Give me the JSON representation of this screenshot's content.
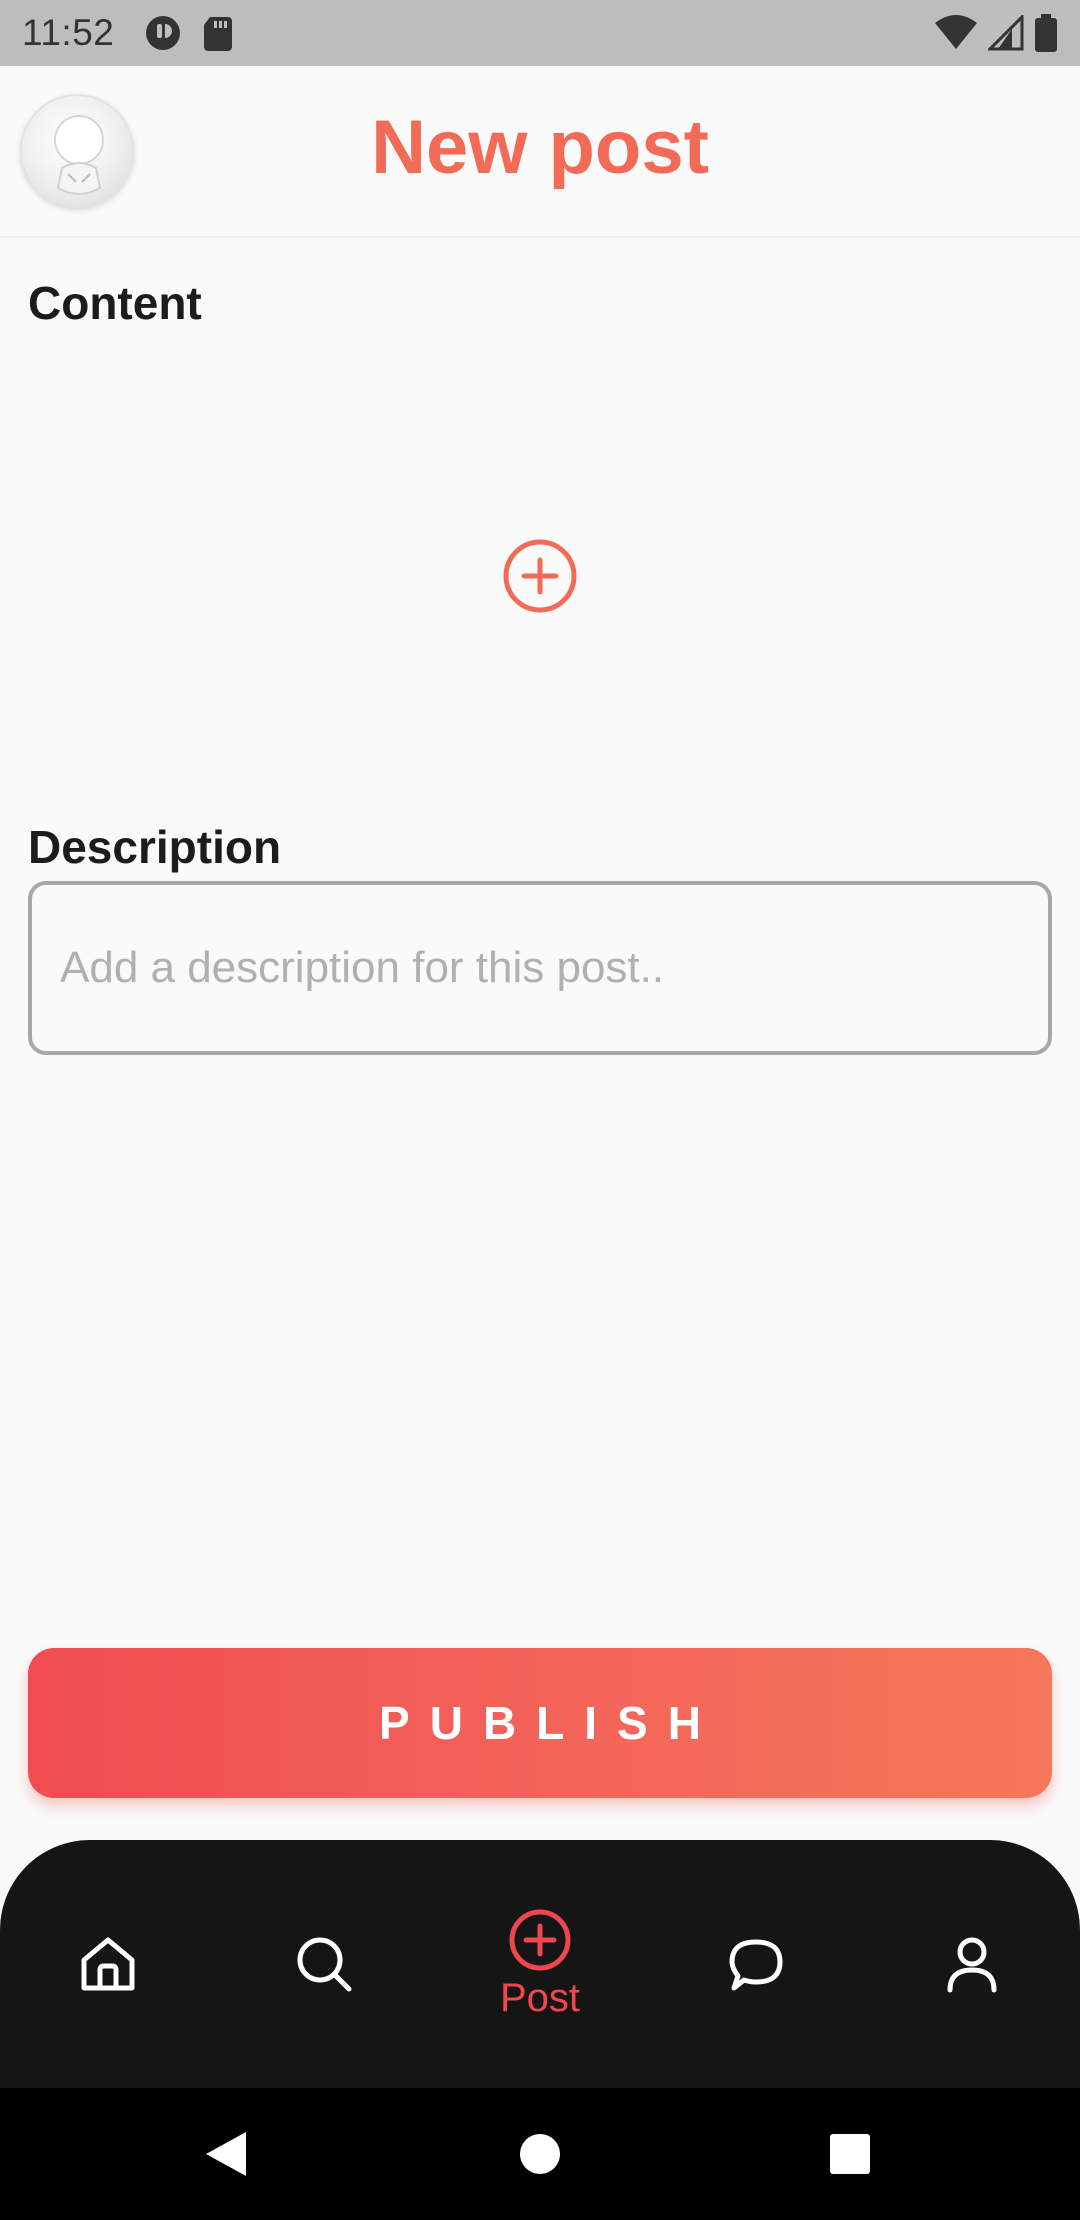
{
  "status_bar": {
    "time": "11:52"
  },
  "header": {
    "title": "New post",
    "avatar_icon": "avatar-icon"
  },
  "content_section": {
    "label": "Content",
    "add_icon": "plus-circle-icon"
  },
  "description_section": {
    "label": "Description",
    "placeholder": "Add a description for this post..",
    "value": ""
  },
  "publish_button": {
    "label": "PUBLISH"
  },
  "bottom_nav": {
    "items": [
      {
        "icon": "home-icon",
        "label": ""
      },
      {
        "icon": "search-icon",
        "label": ""
      },
      {
        "icon": "plus-circle-icon",
        "label": "Post"
      },
      {
        "icon": "chat-icon",
        "label": ""
      },
      {
        "icon": "profile-icon",
        "label": ""
      }
    ],
    "active_index": 2
  },
  "colors": {
    "accent": "#f36b57",
    "gradient_start": "#f24c50",
    "gradient_end": "#f67759",
    "nav_active": "#f0474f",
    "nav_background": "#151515"
  }
}
